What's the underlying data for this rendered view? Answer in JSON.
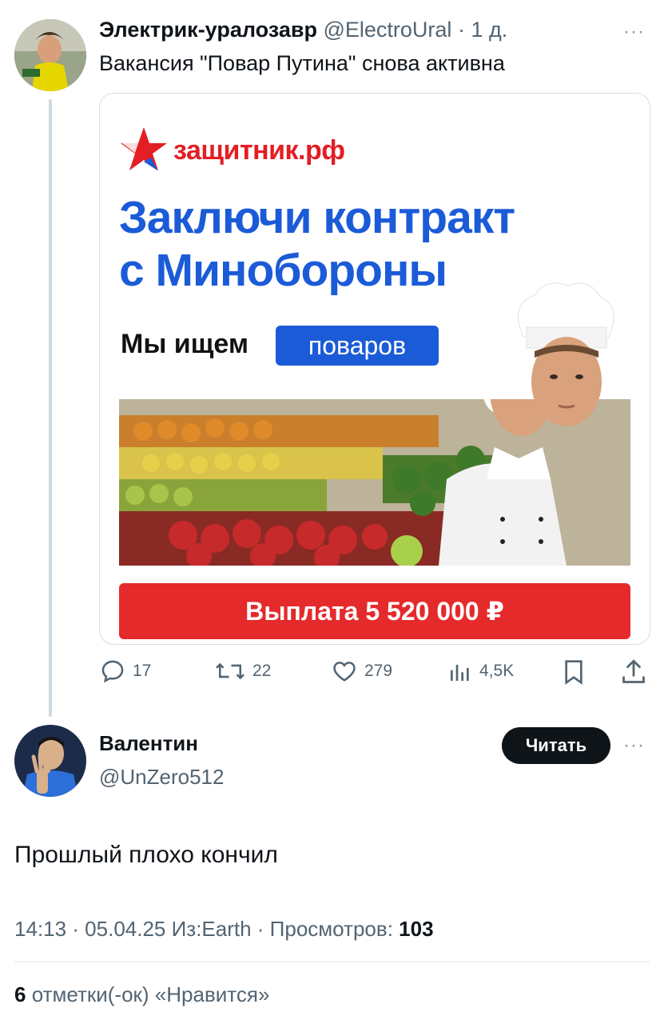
{
  "tweet": {
    "author_name": "Электрик-уралозавр",
    "handle": "@ElectroUral",
    "separator": "·",
    "time": "1 д.",
    "text": "Вакансия \"Повар Путина\" снова активна",
    "more_label": "···"
  },
  "ad": {
    "brand": "защитник.рф",
    "headline_line1": "Заключи контракт",
    "headline_line2": "с Минобороны",
    "seeking_label": "Мы ищем",
    "seeking_highlight": "поваров",
    "payout": "Выплата 5 520 000 ₽",
    "colors": {
      "brand_red": "#e31e24",
      "headline_blue": "#1b5bd8",
      "payout_red": "#e52a2c"
    }
  },
  "actions": {
    "replies": "17",
    "retweets": "22",
    "likes": "279",
    "views": "4,5K"
  },
  "reply": {
    "author_name": "Валентин",
    "handle": "@UnZero512",
    "follow_label": "Читать",
    "more_label": "···",
    "text": "Прошлый плохо кончил",
    "timestamp": "14:13 · 05.04.25 Из:Earth · Просмотров:",
    "views_count": "103",
    "likes_count": "6",
    "likes_label": "отметки(-ок) «Нравится»"
  }
}
